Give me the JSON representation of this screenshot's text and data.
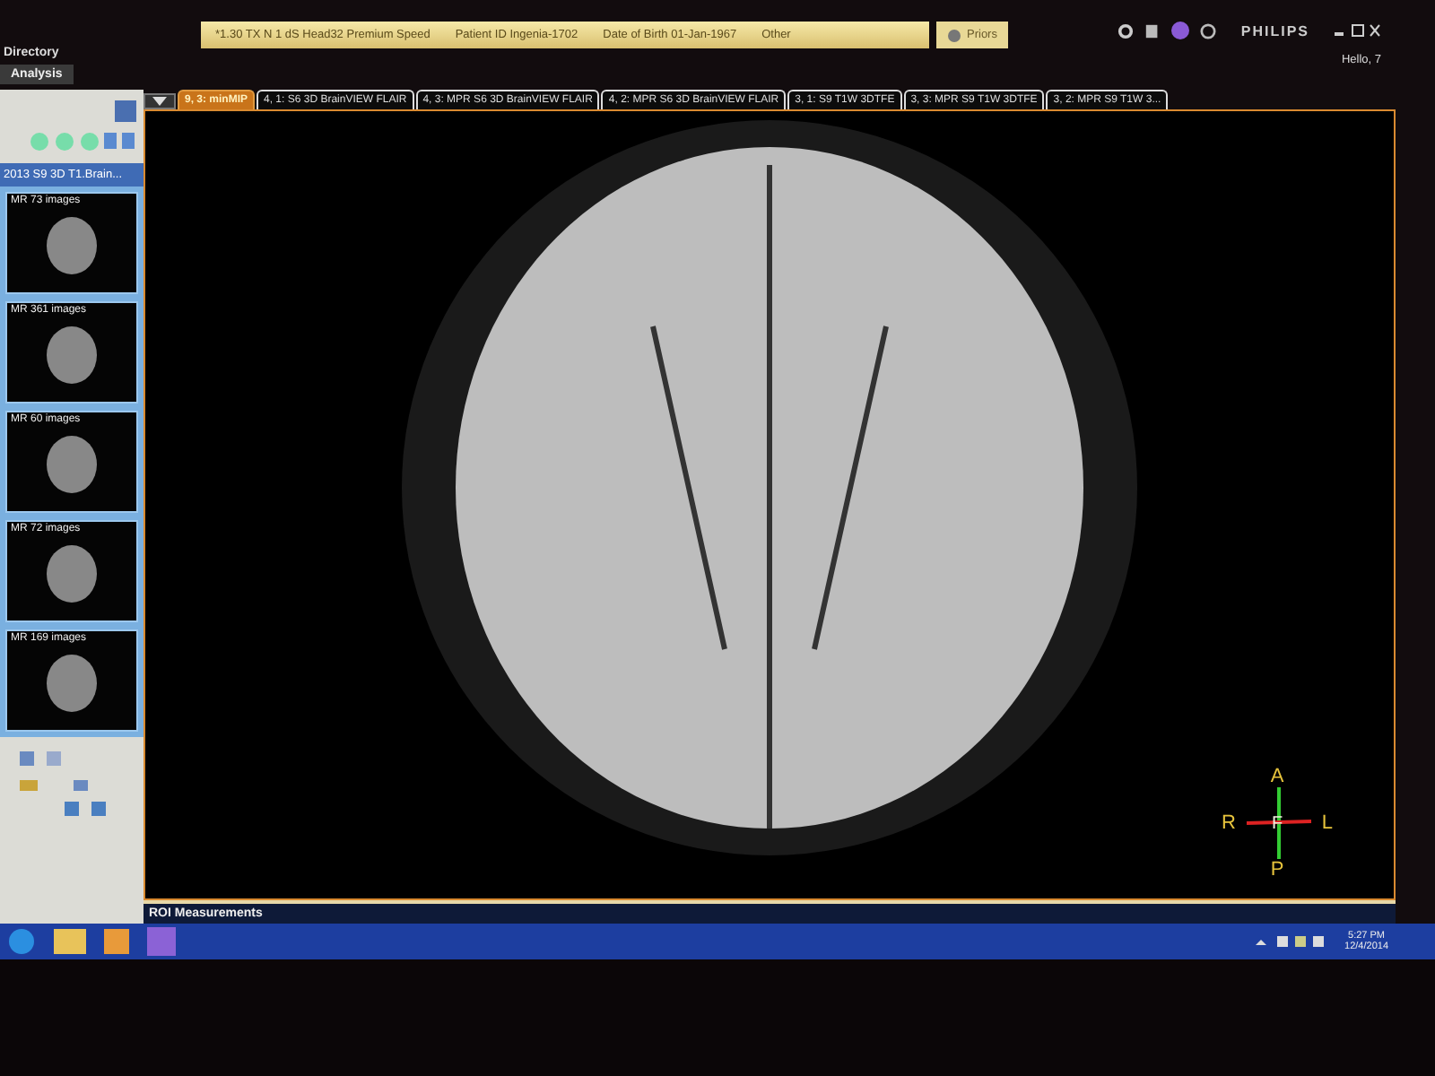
{
  "header": {
    "directory_label": "Directory",
    "analysis_tab": "Analysis",
    "patient_banner": [
      "*1.30 TX N 1 dS Head32 Premium Speed",
      "Patient ID Ingenia-1702",
      "Date of Birth 01-Jan-1967",
      "Other"
    ],
    "priors_button": "Priors",
    "brand": "PHILIPS",
    "greeting": "Hello, 7"
  },
  "series_panel": {
    "title": "2013  S9 3D T1.Brain...",
    "thumbnails": [
      {
        "caption": "MR 73 images"
      },
      {
        "caption": "MR 361 images"
      },
      {
        "caption": "MR 60 images"
      },
      {
        "caption": "MR 72 images"
      },
      {
        "caption": "MR 169 images"
      }
    ]
  },
  "tabs": [
    {
      "label": "9, 3: minMIP",
      "selected": true
    },
    {
      "label": "4, 1: S6 3D BrainVIEW FLAIR",
      "selected": false
    },
    {
      "label": "4, 3: MPR S6 3D BrainVIEW FLAIR",
      "selected": false
    },
    {
      "label": "4, 2: MPR S6 3D BrainVIEW FLAIR",
      "selected": false
    },
    {
      "label": "3, 1: S9 T1W 3DTFE",
      "selected": false
    },
    {
      "label": "3, 3: MPR S9 T1W 3DTFE",
      "selected": false
    },
    {
      "label": "3, 2: MPR S9 T1W 3...",
      "selected": false
    }
  ],
  "orientation": {
    "top": "A",
    "left": "R",
    "right": "L",
    "bottom": "P",
    "center": "F"
  },
  "roi_bar": "ROI Measurements",
  "taskbar": {
    "time": "5:27 PM",
    "date": "12/4/2014"
  }
}
